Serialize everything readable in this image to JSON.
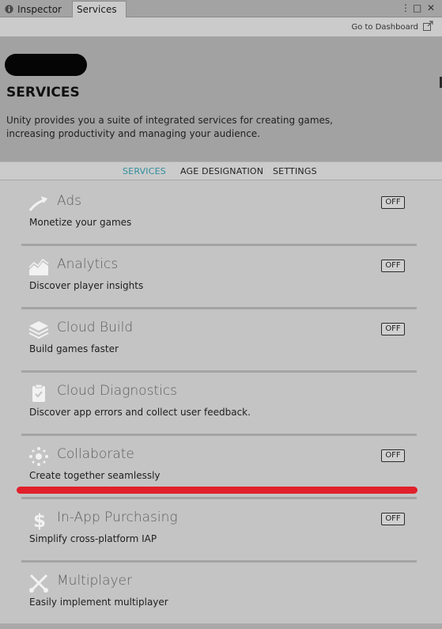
{
  "tabs": {
    "inspector_label": "Inspector",
    "services_label": "Services",
    "menu_glyph": "⋮",
    "maximize_glyph": "□",
    "close_glyph": "✕"
  },
  "dashboard": {
    "link_label": "Go to Dashboard"
  },
  "header": {
    "title": "SERVICES",
    "description": "Unity provides you a suite of integrated services for creating games, increasing productivity and managing your audience."
  },
  "nav": {
    "items": [
      "SERVICES",
      "AGE DESIGNATION",
      "SETTINGS"
    ],
    "active_index": 0
  },
  "services": [
    {
      "name": "Ads",
      "description": "Monetize your games",
      "toggle": "OFF",
      "icon": "ads-icon"
    },
    {
      "name": "Analytics",
      "description": "Discover player insights",
      "toggle": "OFF",
      "icon": "analytics-icon"
    },
    {
      "name": "Cloud Build",
      "description": "Build games faster",
      "toggle": "OFF",
      "icon": "cloud-build-icon"
    },
    {
      "name": "Cloud Diagnostics",
      "description": "Discover app errors and collect user feedback.",
      "toggle": "",
      "icon": "cloud-diagnostics-icon"
    },
    {
      "name": "Collaborate",
      "description": "Create together seamlessly",
      "toggle": "OFF",
      "icon": "collaborate-icon"
    },
    {
      "name": "In-App Purchasing",
      "description": "Simplify cross-platform IAP",
      "toggle": "OFF",
      "icon": "dollar-icon"
    },
    {
      "name": "Multiplayer",
      "description": "Easily implement multiplayer",
      "toggle": "",
      "icon": "multiplayer-icon"
    }
  ],
  "colors": {
    "accent": "#2f8e9e",
    "highlight_mark": "#e0202a"
  }
}
